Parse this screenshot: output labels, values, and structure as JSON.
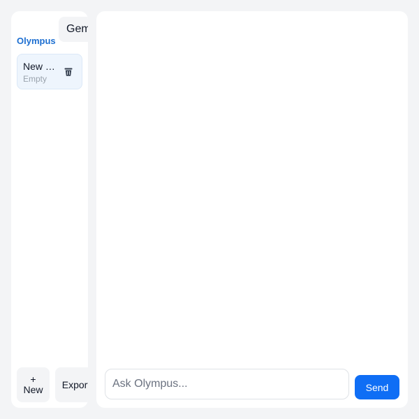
{
  "sidebar": {
    "brand": "Olympus",
    "model_select": "Gemini",
    "conversations": [
      {
        "title": "New conversation",
        "subtitle": "Empty",
        "delete_icon": "trash-icon"
      }
    ],
    "new_button": {
      "icon": "+",
      "label": "New"
    },
    "export_button": {
      "label": "Export"
    }
  },
  "composer": {
    "placeholder": "Ask Olympus...",
    "value": "",
    "send_label": "Send"
  },
  "colors": {
    "brand": "#1d6fd1",
    "send": "#0f6ef5",
    "active_item_bg": "#eef5fd",
    "background": "#f3f4f6"
  }
}
